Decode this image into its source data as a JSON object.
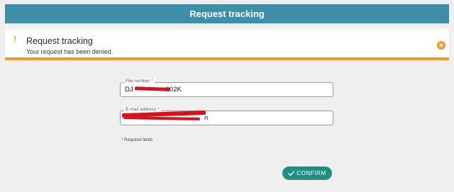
{
  "header": {
    "title": "Request tracking"
  },
  "alert": {
    "icon": "exclamation-icon",
    "title": "Request tracking",
    "message": "Your request has been denied.",
    "close_icon": "close-circle-icon",
    "accent_color": "#ef9a24"
  },
  "form": {
    "file_number": {
      "label": "File number *",
      "value_prefix": "DJ",
      "value_suffix": "002K"
    },
    "email": {
      "label": "E-mail address *",
      "value_suffix": "n"
    },
    "required_note": "* Required fields",
    "confirm_label": "CONFIRM",
    "confirm_icon": "check-icon"
  },
  "colors": {
    "header_bg": "#3f8ea9",
    "button_bg": "#1e8f80",
    "redaction": "#d8121b"
  }
}
